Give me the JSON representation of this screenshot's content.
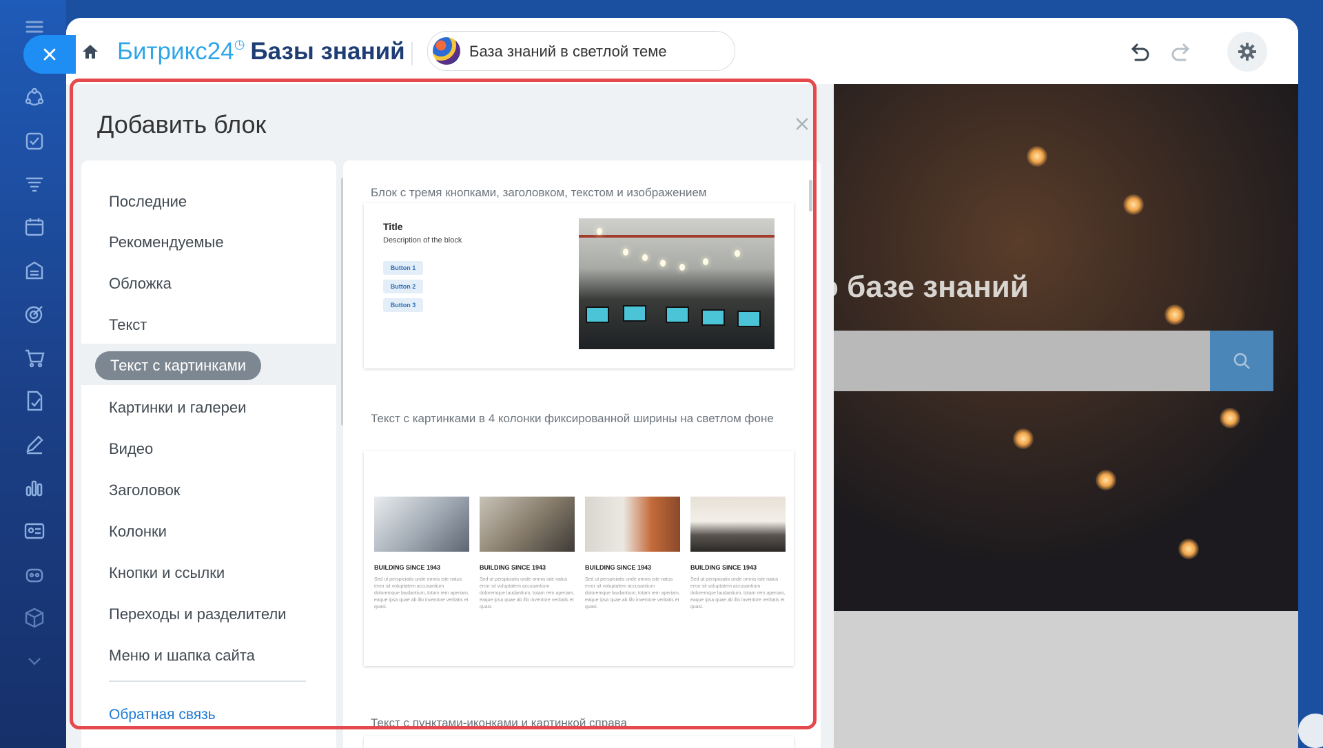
{
  "header": {
    "brand": "Битрикс24",
    "brand_mark": "◷",
    "section_title": "Базы знаний",
    "knowledge_base": "База знаний в светлой теме"
  },
  "dialog": {
    "title": "Добавить блок",
    "categories": [
      "Последние",
      "Рекомендуемые",
      "Обложка",
      "Текст",
      "Текст с картинками",
      "Картинки и галереи",
      "Видео",
      "Заголовок",
      "Колонки",
      "Кнопки и ссылки",
      "Переходы и разделители",
      "Меню и шапка сайта"
    ],
    "active_category": "Текст с картинками",
    "feedback_link": "Обратная связь",
    "blocks": [
      {
        "caption": "Блок с тремя кнопками, заголовком, текстом и изображением",
        "preview": {
          "title": "Title",
          "description": "Description of the block",
          "buttons": [
            "Button 1",
            "Button 2",
            "Button 3"
          ]
        }
      },
      {
        "caption": "Текст с картинками в 4 колонки фиксированной ширины на светлом фоне",
        "preview": {
          "columns": [
            {
              "title": "BUILDING SINCE 1943",
              "text": "Sed ut perspiciatis unde omnis iste natus error sit voluptatem accusantium doloremque laudantium, totam rem aperiam, eaque ipsa quae ab illo inventore veritatis et quasi."
            },
            {
              "title": "BUILDING SINCE 1943",
              "text": "Sed ut perspiciatis unde omnis iste natus error sit voluptatem accusantium doloremque laudantium, totam rem aperiam, eaque ipsa quae ab illo inventore veritatis et quasi."
            },
            {
              "title": "BUILDING SINCE 1943",
              "text": "Sed ut perspiciatis unde omnis iste natus error sit voluptatem accusantium doloremque laudantium, totam rem aperiam, eaque ipsa quae ab illo inventore veritatis et quasi."
            },
            {
              "title": "BUILDING SINCE 1943",
              "text": "Sed ut perspiciatis unde omnis iste natus error sit voluptatem accusantium doloremque laudantium, totam rem aperiam, eaque ipsa quae ab illo inventore veritatis et quasi."
            }
          ]
        }
      },
      {
        "caption": "Текст с пунктами-иконками и картинкой справа"
      }
    ]
  },
  "preview_page": {
    "hero_text": "о базе знаний"
  },
  "icons": {
    "rail": [
      "menu-icon",
      "close-icon",
      "crm-icon",
      "tasks-icon",
      "funnel-icon",
      "calendar-icon",
      "store-icon",
      "target-icon",
      "cart-icon",
      "documents-icon",
      "sign-icon",
      "analytics-icon",
      "contacts-icon",
      "robot-icon",
      "box-icon",
      "chevron-down-icon"
    ],
    "header": [
      "home-icon",
      "undo-icon",
      "redo-icon",
      "gear-icon"
    ]
  },
  "colors": {
    "brand_blue": "#2fa6e8",
    "title_navy": "#1e3d74",
    "highlight": "#e5484d",
    "link": "#1d7ad4",
    "active_pill": "#7d8791"
  }
}
